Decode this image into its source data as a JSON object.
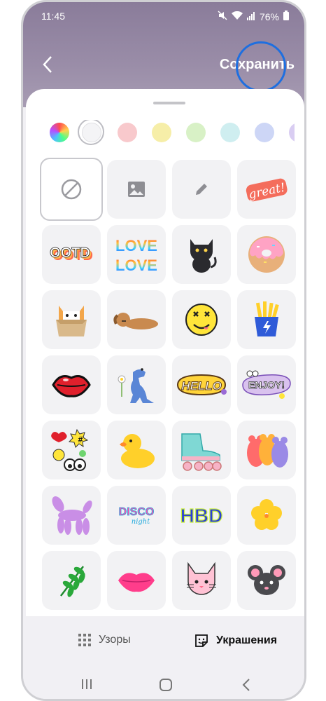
{
  "status": {
    "time": "11:45",
    "battery": "76%"
  },
  "header": {
    "save_label": "Сохранить"
  },
  "colors": [
    "rainbow",
    "#ffffff",
    "#f8c9cc",
    "#f6eea8",
    "#d8f1c6",
    "#cfeef0",
    "#cdd6f6",
    "#d9cdf2"
  ],
  "tabs": [
    {
      "label": "Узоры",
      "active": false
    },
    {
      "label": "Украшения",
      "active": true
    }
  ],
  "stickers": {
    "great": "great!",
    "ootd": "OOTD",
    "love": "LOVE",
    "love2": "LOVE",
    "hello": "HELLO",
    "enjoy": "ENJOY!",
    "disco": "DISCO",
    "night": "night",
    "hbd": "HBD",
    "hash": "#"
  }
}
